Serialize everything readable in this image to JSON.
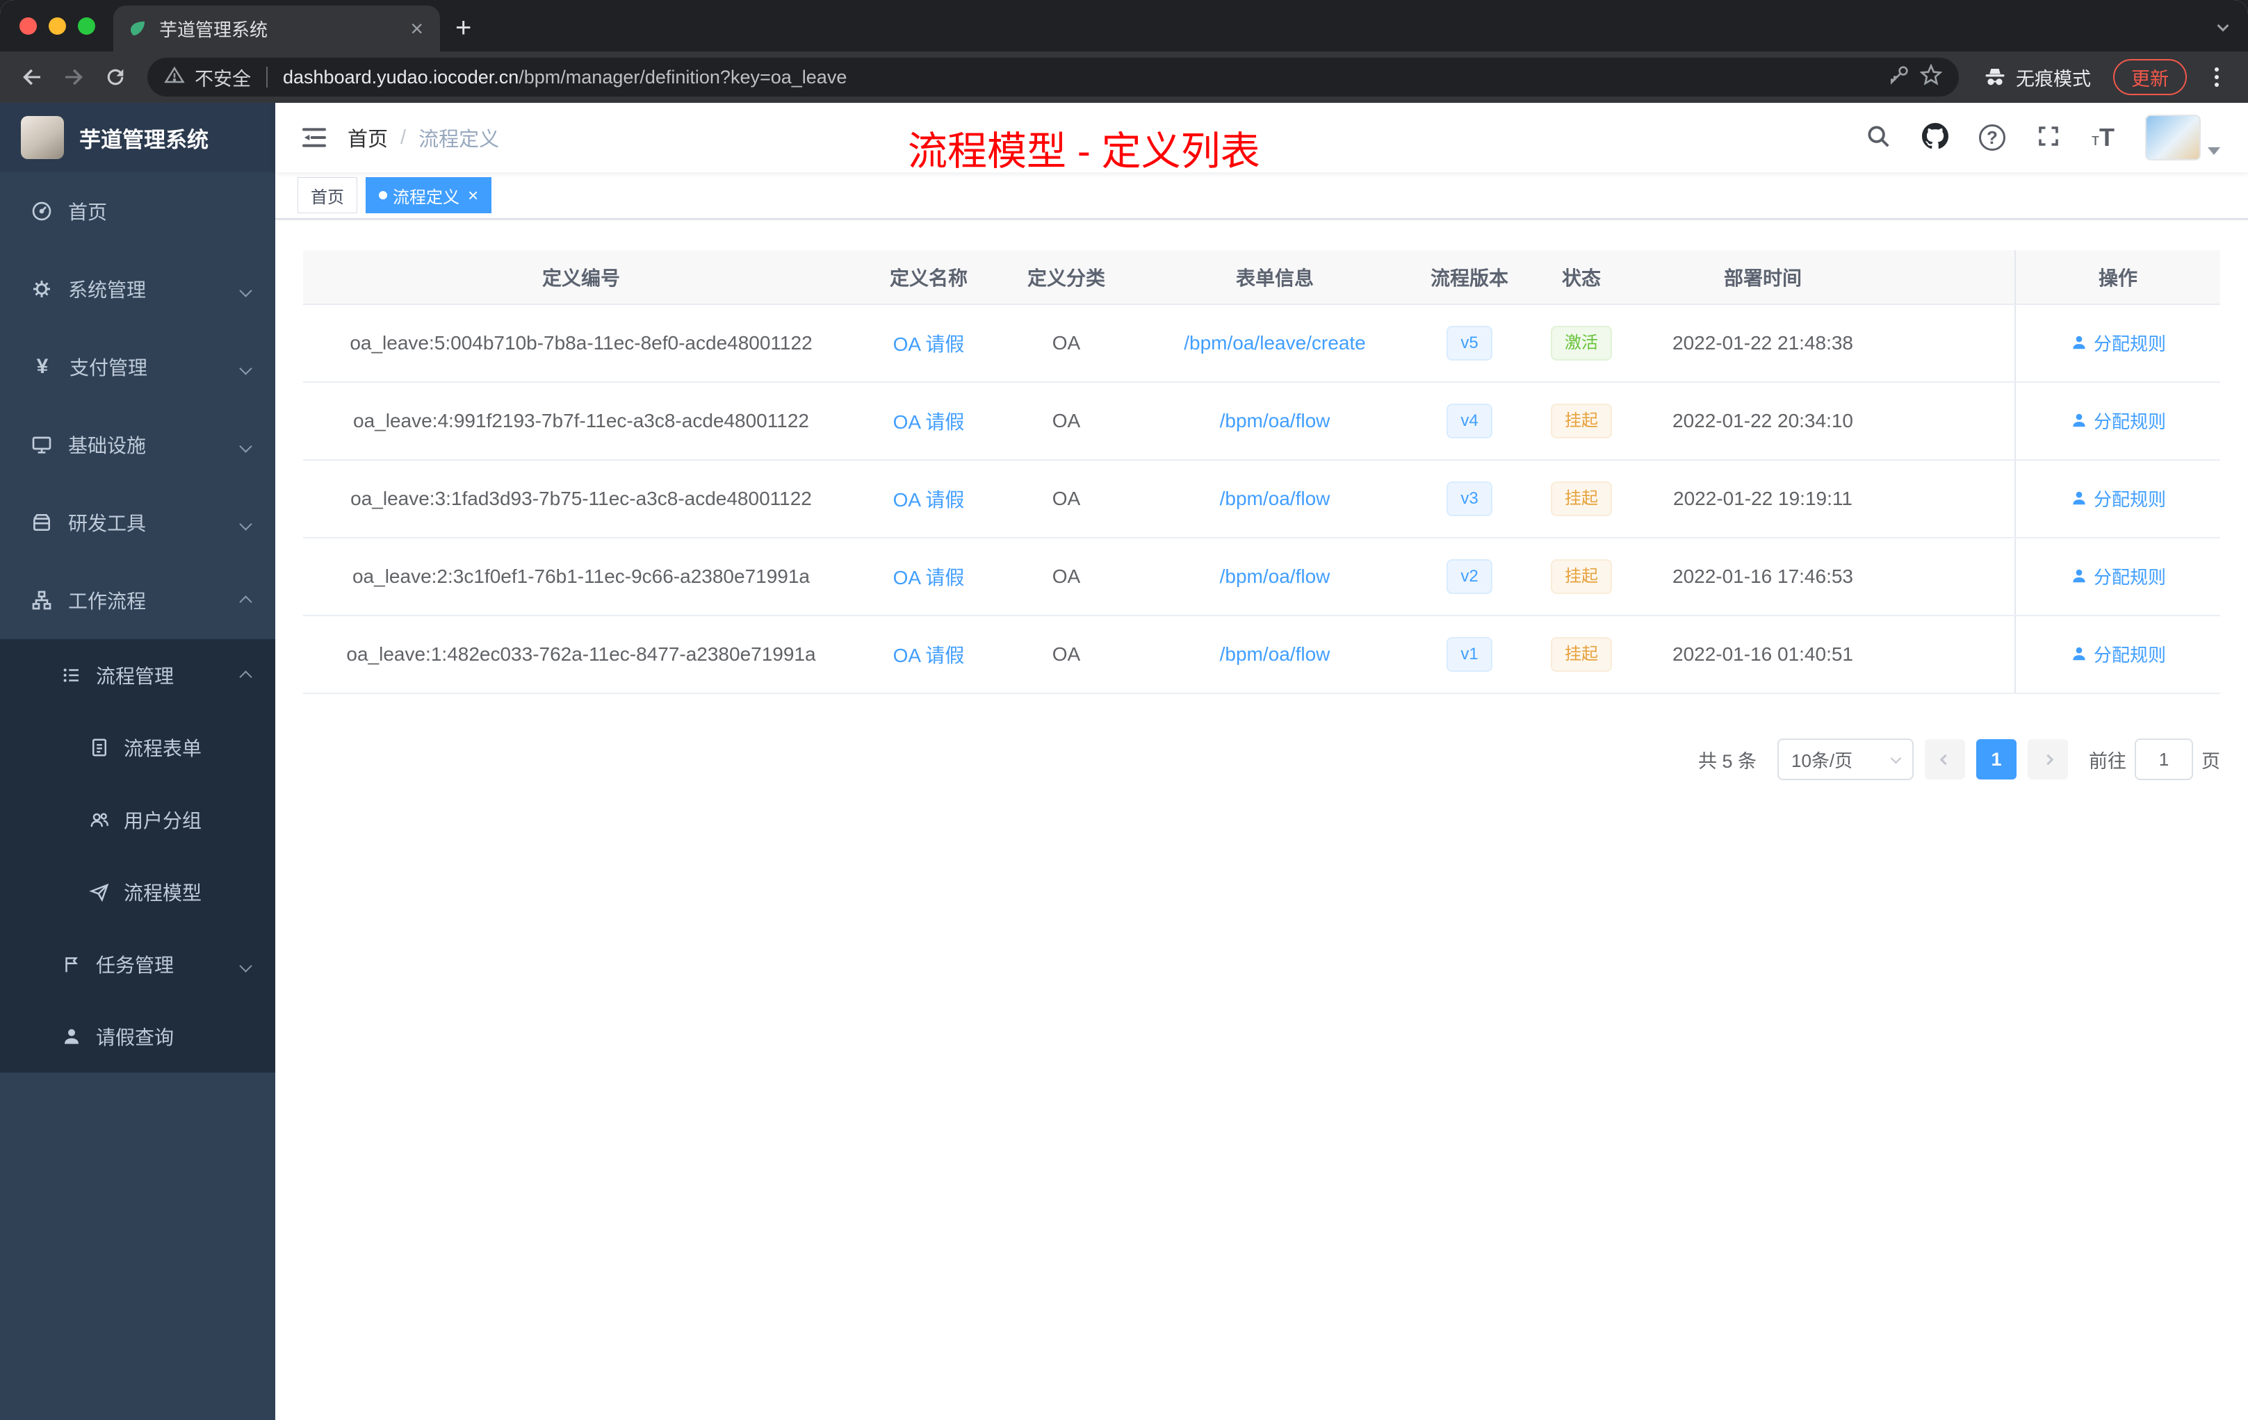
{
  "browser": {
    "tab_title": "芋道管理系统",
    "security_label": "不安全",
    "url_domain": "dashboard.yudao.iocoder.cn",
    "url_path": "/bpm/manager/definition?key=oa_leave",
    "incognito_label": "无痕模式",
    "update_label": "更新"
  },
  "sidebar": {
    "logo_title": "芋道管理系统",
    "items": [
      {
        "label": "首页"
      },
      {
        "label": "系统管理"
      },
      {
        "label": "支付管理"
      },
      {
        "label": "基础设施"
      },
      {
        "label": "研发工具"
      },
      {
        "label": "工作流程"
      }
    ],
    "workflow": {
      "process_mgmt": "流程管理",
      "process_form": "流程表单",
      "user_group": "用户分组",
      "process_model": "流程模型",
      "task_mgmt": "任务管理",
      "leave_query": "请假查询"
    }
  },
  "header": {
    "breadcrumb_home": "首页",
    "breadcrumb_current": "流程定义",
    "annotation": "流程模型 - 定义列表"
  },
  "tags": {
    "home": "首页",
    "active": "流程定义"
  },
  "table": {
    "columns": [
      "定义编号",
      "定义名称",
      "定义分类",
      "表单信息",
      "流程版本",
      "状态",
      "部署时间",
      "操作"
    ],
    "rows": [
      {
        "id": "oa_leave:5:004b710b-7b8a-11ec-8ef0-acde48001122",
        "name": "OA 请假",
        "category": "OA",
        "form": "/bpm/oa/leave/create",
        "version": "v5",
        "status": "激活",
        "status_type": "success",
        "deploy_time": "2022-01-22 21:48:38",
        "action": "分配规则"
      },
      {
        "id": "oa_leave:4:991f2193-7b7f-11ec-a3c8-acde48001122",
        "name": "OA 请假",
        "category": "OA",
        "form": "/bpm/oa/flow",
        "version": "v4",
        "status": "挂起",
        "status_type": "warning",
        "deploy_time": "2022-01-22 20:34:10",
        "action": "分配规则"
      },
      {
        "id": "oa_leave:3:1fad3d93-7b75-11ec-a3c8-acde48001122",
        "name": "OA 请假",
        "category": "OA",
        "form": "/bpm/oa/flow",
        "version": "v3",
        "status": "挂起",
        "status_type": "warning",
        "deploy_time": "2022-01-22 19:19:11",
        "action": "分配规则"
      },
      {
        "id": "oa_leave:2:3c1f0ef1-76b1-11ec-9c66-a2380e71991a",
        "name": "OA 请假",
        "category": "OA",
        "form": "/bpm/oa/flow",
        "version": "v2",
        "status": "挂起",
        "status_type": "warning",
        "deploy_time": "2022-01-16 17:46:53",
        "action": "分配规则"
      },
      {
        "id": "oa_leave:1:482ec033-762a-11ec-8477-a2380e71991a",
        "name": "OA 请假",
        "category": "OA",
        "form": "/bpm/oa/flow",
        "version": "v1",
        "status": "挂起",
        "status_type": "warning",
        "deploy_time": "2022-01-16 01:40:51",
        "action": "分配规则"
      }
    ]
  },
  "pagination": {
    "total": "共 5 条",
    "page_size": "10条/页",
    "current_page": "1",
    "goto_prefix": "前往",
    "goto_value": "1",
    "goto_suffix": "页"
  }
}
